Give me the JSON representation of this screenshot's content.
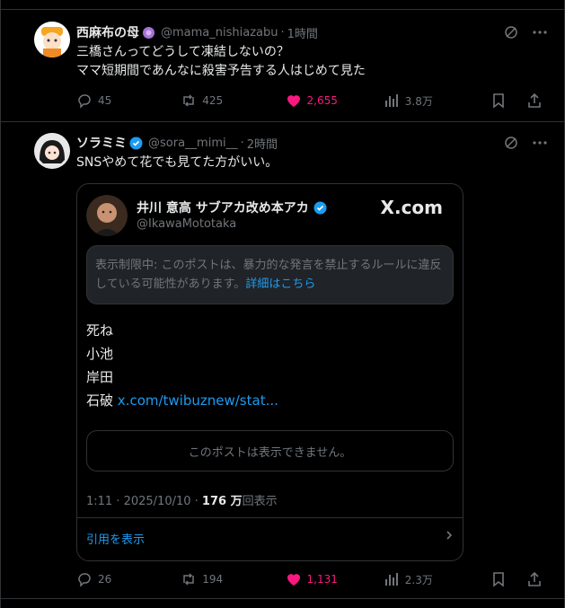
{
  "tweets": [
    {
      "name": "西麻布の母",
      "handle": "@mama_nishiazabu",
      "time": "1時間",
      "lines": [
        "三橋さんってどうして凍結しないの？",
        "ママ短期間であんなに殺害予告する人はじめて見た"
      ],
      "replies": "45",
      "retweets": "425",
      "likes": "2,655",
      "views": "3.8万"
    },
    {
      "name": "ソラミミ",
      "handle": "@sora__mimi__",
      "time": "2時間",
      "lines": [
        "SNSやめて花でも見てた方がいい。"
      ],
      "replies": "26",
      "retweets": "194",
      "likes": "1,131",
      "views": "2.3万",
      "quote": {
        "name": "井川 意高 サブアカ改め本アカ",
        "handle": "@IkawaMototaka",
        "site": "X.com",
        "notice_text": "表示制限中: このポストは、暴力的な発言を禁止するルールに違反している可能性があります。",
        "notice_link": "詳細はこちら",
        "lines": [
          "死ね",
          "小池",
          "岸田"
        ],
        "last_line_prefix": "石破",
        "last_line_link": "x.com/twibuznew/stat...",
        "unavailable": "このポストは表示できません。",
        "meta_time": "1:11 · 2025/10/10 · ",
        "meta_views": "176 万",
        "meta_suffix": "回表示",
        "view_quotes": "引用を表示"
      }
    }
  ],
  "colors": {
    "accent": "#1d9bf0",
    "like": "#f91880",
    "muted": "#71767b"
  }
}
